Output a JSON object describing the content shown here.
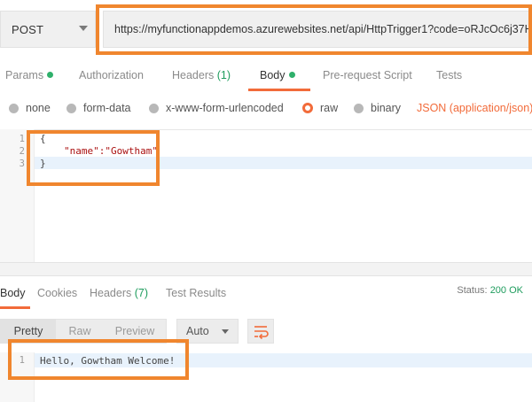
{
  "request": {
    "method": "POST",
    "url": "https://myfunctionappdemos.azurewebsites.net/api/HttpTrigger1?code=oRJcOc6j37H"
  },
  "request_tabs": {
    "params": "Params",
    "authorization": "Authorization",
    "headers": "Headers",
    "headers_count": "(1)",
    "body": "Body",
    "pre_request": "Pre-request Script",
    "tests": "Tests"
  },
  "body_types": {
    "none": "none",
    "form_data": "form-data",
    "urlencoded": "x-www-form-urlencoded",
    "raw": "raw",
    "binary": "binary",
    "content_type": "JSON (application/json)"
  },
  "request_editor": {
    "line_numbers": [
      "1",
      "2",
      "3"
    ],
    "lines": [
      "{",
      "\"name\":\"Gowtham\"",
      "}"
    ]
  },
  "response_tabs": {
    "body": "Body",
    "cookies": "Cookies",
    "headers": "Headers",
    "headers_count": "(7)",
    "test_results": "Test Results"
  },
  "status": {
    "label": "Status:",
    "value": "200 OK"
  },
  "response_view": {
    "pretty": "Pretty",
    "raw": "Raw",
    "preview": "Preview",
    "format": "Auto"
  },
  "response_editor": {
    "line_numbers": [
      "1"
    ],
    "lines": [
      "Hello, Gowtham Welcome!"
    ]
  },
  "colors": {
    "accent": "#f26b3a",
    "annotation": "#f0862e",
    "success": "#1e9c5d"
  },
  "icons": [
    "chevron-down-icon",
    "wrap-lines-icon",
    "fold-arrow-icon",
    "status-dot-icon"
  ]
}
